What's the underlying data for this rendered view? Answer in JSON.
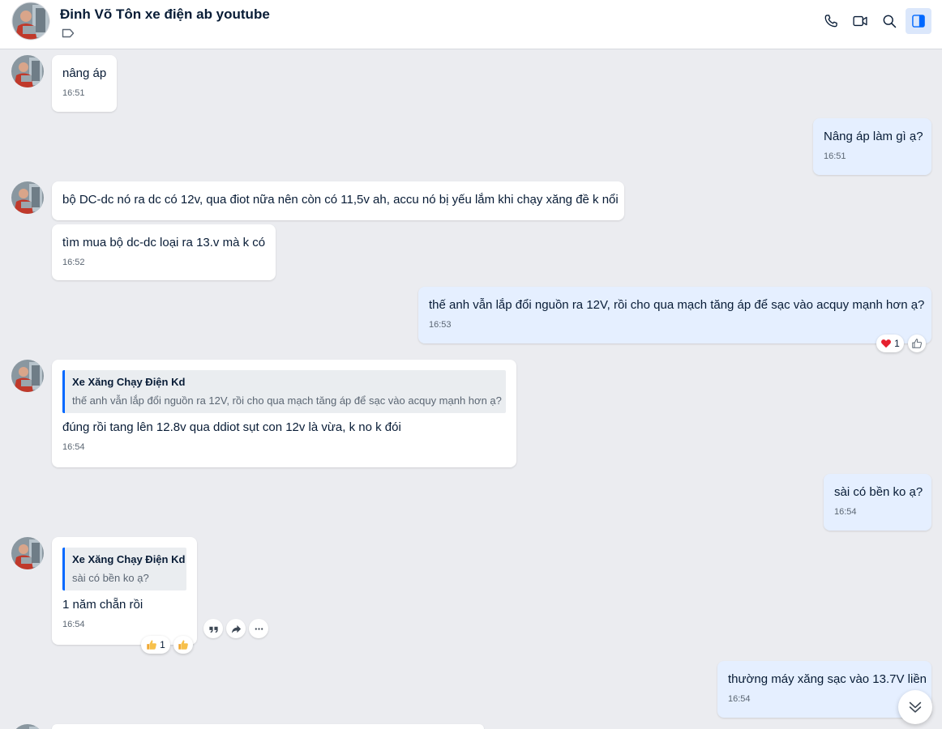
{
  "header": {
    "contact_name": "Đinh Võ Tôn xe điện ab youtube",
    "icons": [
      "phone-icon",
      "video-call-icon",
      "search-icon",
      "sidebar-toggle-icon"
    ]
  },
  "messages": [
    {
      "text": "nâng áp",
      "time": "16:51"
    },
    {
      "text": "Nâng áp làm gì ạ?",
      "time": "16:51"
    },
    {
      "text": "bộ DC-dc nó ra dc có 12v, qua điot nữa nên còn có 11,5v ah, accu nó bị yếu lắm khi chạy xăng đề k nổi"
    },
    {
      "text": "tìm mua bộ dc-dc loại ra 13.v mà k có",
      "time": "16:52"
    },
    {
      "text": "thế anh vẫn lắp đổi nguồn ra 12V, rồi cho qua mạch tăng áp để sạc vào acquy mạnh hơn ạ?",
      "time": "16:53",
      "reaction_count": "1"
    },
    {
      "quote_author": "Xe Xăng Chạy Điện Kd",
      "quote_text": "thế anh vẫn lắp đổi nguồn ra 12V, rồi cho qua mạch tăng áp để sạc vào acquy mạnh hơn ạ?",
      "text": "đúng rồi tang lên 12.8v qua ddiot sụt con 12v là vừa, k no k đói",
      "time": "16:54"
    },
    {
      "text": "sài có bền ko ạ?",
      "time": "16:54"
    },
    {
      "quote_author": "Xe Xăng Chạy Điện Kd",
      "quote_text": "sài có bền ko ạ?",
      "text": "1 năm chẵn rồi",
      "time": "16:54",
      "reaction_count": "1"
    },
    {
      "text": "thường máy xăng sạc vào 13.7V liền",
      "time": "16:54"
    }
  ],
  "colors": {
    "background": "#ebecf0",
    "incoming_bubble": "#ffffff",
    "outgoing_bubble": "#e5efff",
    "accent": "#0068ff"
  }
}
